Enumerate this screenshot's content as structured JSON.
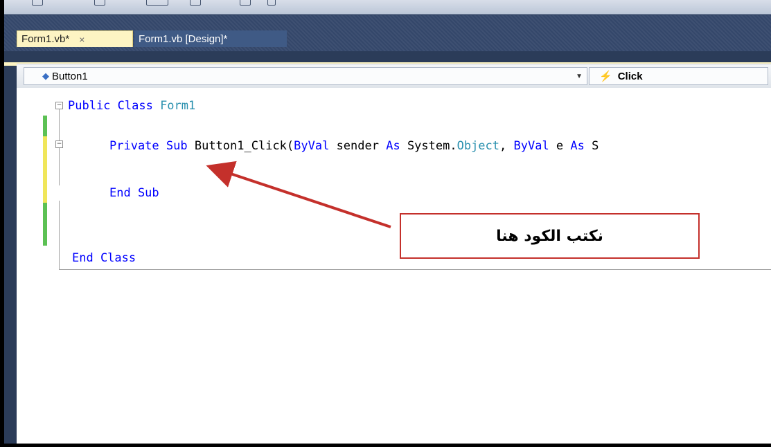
{
  "tabs": [
    {
      "label": "Form1.vb*",
      "active": true
    },
    {
      "label": "Form1.vb [Design]*",
      "active": false
    }
  ],
  "close_glyph": "×",
  "nav": {
    "object_selector": "Button1",
    "event_selector": "Click"
  },
  "code": {
    "line1": {
      "kw": "Public Class ",
      "type": "Form1"
    },
    "line2": {
      "parts": [
        {
          "t": "Private ",
          "c": "kw"
        },
        {
          "t": "Sub ",
          "c": "kw"
        },
        {
          "t": "Button1_Click(",
          "c": "plain"
        },
        {
          "t": "ByVal ",
          "c": "kw"
        },
        {
          "t": "sender ",
          "c": "plain"
        },
        {
          "t": "As ",
          "c": "kw"
        },
        {
          "t": "System.",
          "c": "plain"
        },
        {
          "t": "Object",
          "c": "ty"
        },
        {
          "t": ", ",
          "c": "plain"
        },
        {
          "t": "ByVal ",
          "c": "kw"
        },
        {
          "t": "e ",
          "c": "plain"
        },
        {
          "t": "As ",
          "c": "kw"
        },
        {
          "t": "S",
          "c": "plain"
        }
      ]
    },
    "line3": "End Sub",
    "line4": "End Class"
  },
  "callout": {
    "text": "نكتب الكود هنا",
    "border_color": "#c4302b"
  },
  "colors": {
    "keyword": "#0000ff",
    "type": "#2b91af",
    "active_tab": "#fdf4c3",
    "chrome": "#34476a"
  }
}
